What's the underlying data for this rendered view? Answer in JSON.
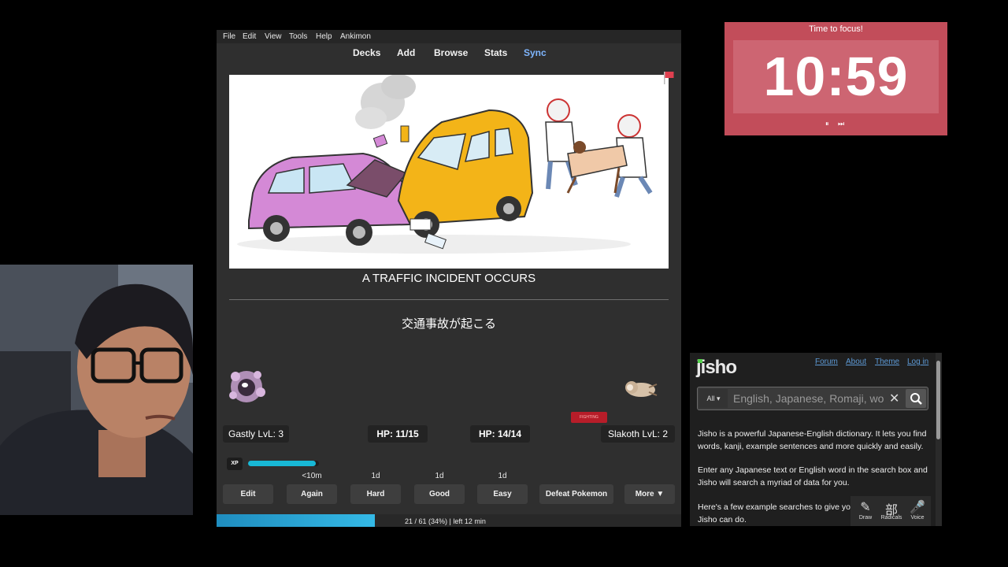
{
  "anki": {
    "menu": [
      "File",
      "Edit",
      "View",
      "Tools",
      "Help",
      "Ankimon"
    ],
    "toolbar": [
      "Decks",
      "Add",
      "Browse",
      "Stats",
      "Sync"
    ],
    "card": {
      "front": "A TRAFFIC INCIDENT OCCURS",
      "back": "交通事故が起こる"
    },
    "battle": {
      "player": "Gastly LvL: 3",
      "player_hp": "HP: 11/15",
      "enemy_hp": "HP: 14/14",
      "enemy": "Slakoth LvL: 2",
      "type_badge": "FIGHTING",
      "xp_label": "XP",
      "xp_fraction": 0.95
    },
    "due": [
      "<10m",
      "1d",
      "1d",
      "1d"
    ],
    "buttons": [
      "Edit",
      "Again",
      "Hard",
      "Good",
      "Easy",
      "Defeat Pokemon",
      "More ▼"
    ],
    "progress": {
      "text": "21 / 61 (34%) | left 12 min",
      "fraction": 0.34
    }
  },
  "timer": {
    "title": "Time to focus!",
    "time": "10:59",
    "pause_icon": "⏸",
    "skip_icon": "⏭",
    "color": "#c24d5a"
  },
  "jisho": {
    "logo": "jisho",
    "links": [
      "Forum",
      "About",
      "Theme",
      "Log in"
    ],
    "scope": "All ▾",
    "placeholder": "English, Japanese, Romaji, words or text",
    "paragraphs": [
      "Jisho is a powerful Japanese-English dictionary. It lets you find words, kanji, example sentences and more quickly and easily.",
      "Enter any Japanese text or English word in the search box and Jisho will search a myriad of data for you.",
      "Here's a few example searches to give yo",
      "Jisho can do."
    ],
    "tools": [
      {
        "icon": "✎",
        "label": "Draw"
      },
      {
        "icon": "部",
        "label": "Radicals"
      },
      {
        "icon": "🎤",
        "label": "Voice"
      }
    ]
  }
}
